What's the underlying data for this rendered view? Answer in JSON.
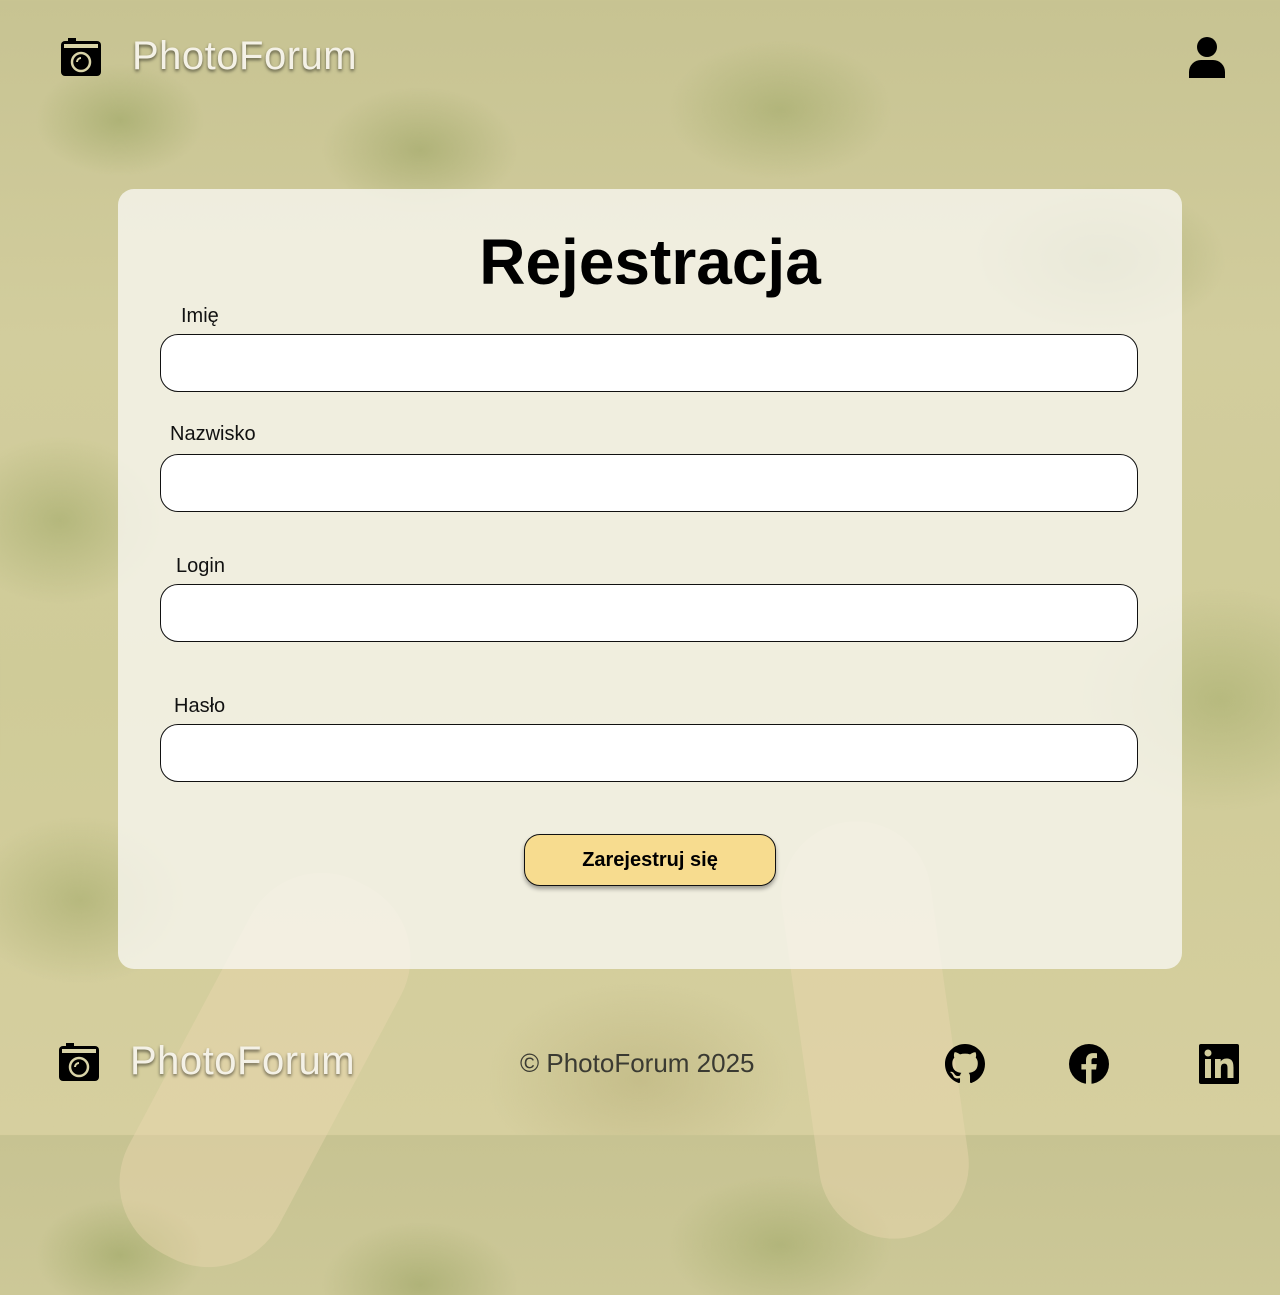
{
  "header": {
    "brand_name": "PhotoForum",
    "logo_icon": "camera-icon",
    "account_icon": "user-icon"
  },
  "form": {
    "title": "Rejestracja",
    "fields": [
      {
        "label": "Imię",
        "value": "",
        "placeholder": ""
      },
      {
        "label": "Nazwisko",
        "value": "",
        "placeholder": ""
      },
      {
        "label": "Login",
        "value": "",
        "placeholder": ""
      },
      {
        "label": "Hasło",
        "value": "",
        "placeholder": ""
      }
    ],
    "submit_label": "Zarejestruj się"
  },
  "footer": {
    "brand_name": "PhotoForum",
    "copyright": "© PhotoForum 2025",
    "social_icons": [
      "github-icon",
      "facebook-icon",
      "linkedin-icon"
    ]
  },
  "colors": {
    "button_bg": "#f7dc8f",
    "card_bg": "#f8f6f0"
  }
}
